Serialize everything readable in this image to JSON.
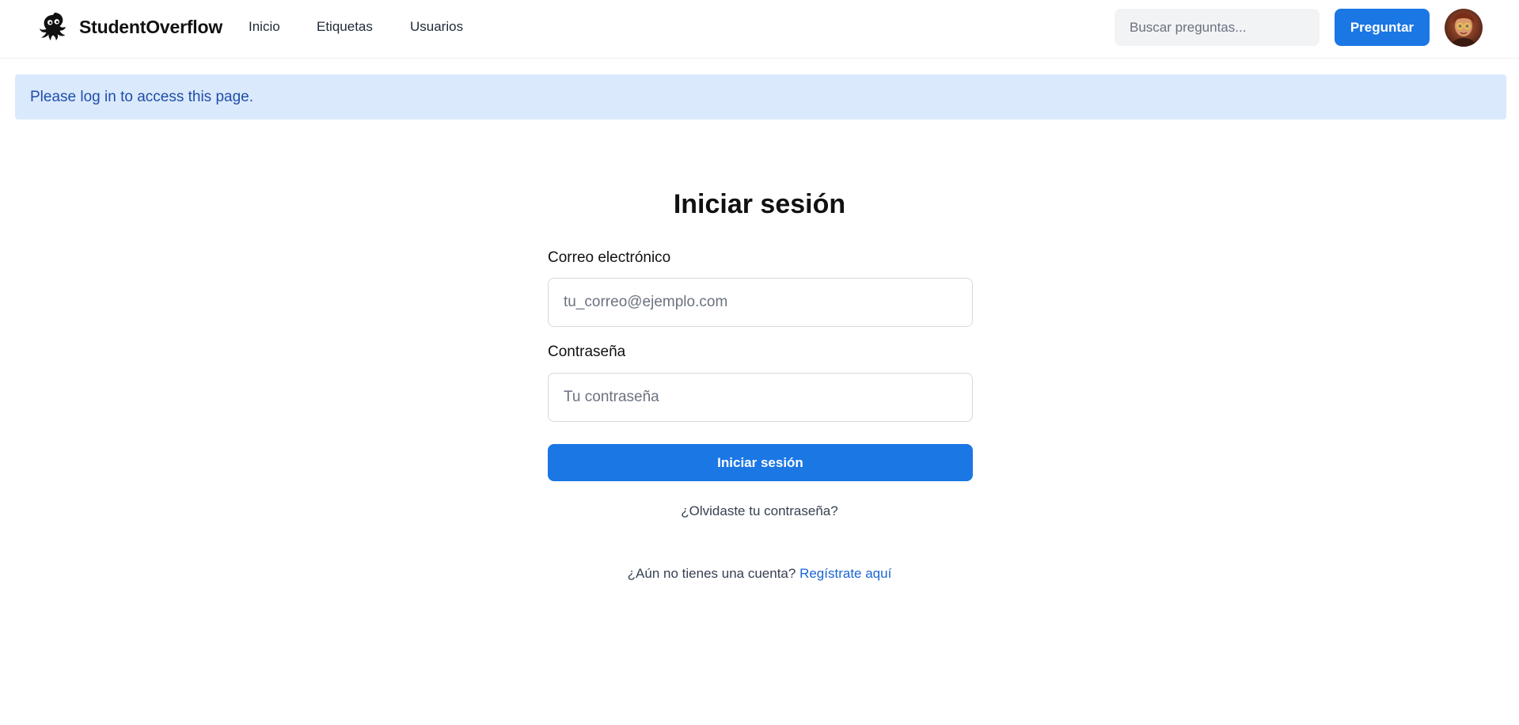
{
  "header": {
    "brand": "StudentOverflow",
    "logo_icon": "octopus-icon",
    "nav": [
      {
        "label": "Inicio"
      },
      {
        "label": "Etiquetas"
      },
      {
        "label": "Usuarios"
      }
    ],
    "search_placeholder": "Buscar preguntas...",
    "ask_button": "Preguntar",
    "avatar_icon": "user-avatar"
  },
  "alert": {
    "message": "Please log in to access this page."
  },
  "login": {
    "title": "Iniciar sesión",
    "email_label": "Correo electrónico",
    "email_placeholder": "tu_correo@ejemplo.com",
    "email_value": "",
    "password_label": "Contraseña",
    "password_placeholder": "Tu contraseña",
    "password_value": "",
    "submit_button": "Iniciar sesión",
    "forgot_link": "¿Olvidaste tu contraseña?",
    "register_prompt": "¿Aún no tienes una cuenta?",
    "register_link": "Regístrate aquí"
  },
  "colors": {
    "primary": "#1b77e4",
    "alert_bg": "#dbe9fd",
    "alert_text": "#1e4ea8",
    "link": "#1b66d6"
  }
}
